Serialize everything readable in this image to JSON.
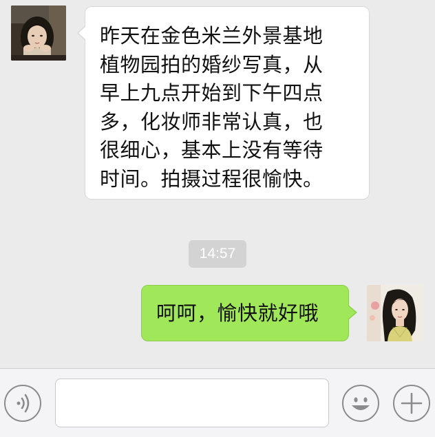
{
  "messages": [
    {
      "direction": "incoming",
      "lines": [
        "昨天在金色米兰外景基地",
        "植物园拍的婚纱写真，从",
        "早上九点开始到下午四点",
        "多，化妆师非常认真，也",
        "很细心，基本上没有等待",
        "时间。拍摄过程很愉快。"
      ]
    },
    {
      "direction": "outgoing",
      "lines": [
        "呵呵，愉快就好哦"
      ]
    }
  ],
  "timestamp": "14:57",
  "input_bar": {
    "text_value": "",
    "voice_icon": "voice-icon",
    "emoji_icon": "smiley-icon",
    "plus_icon": "plus-icon"
  },
  "colors": {
    "chat_background": "#ebebeb",
    "incoming_bubble": "#ffffff",
    "outgoing_bubble": "#a0e75a",
    "timestamp_pill": "#d3d3d3",
    "input_bar_background": "#f4f4f6"
  }
}
